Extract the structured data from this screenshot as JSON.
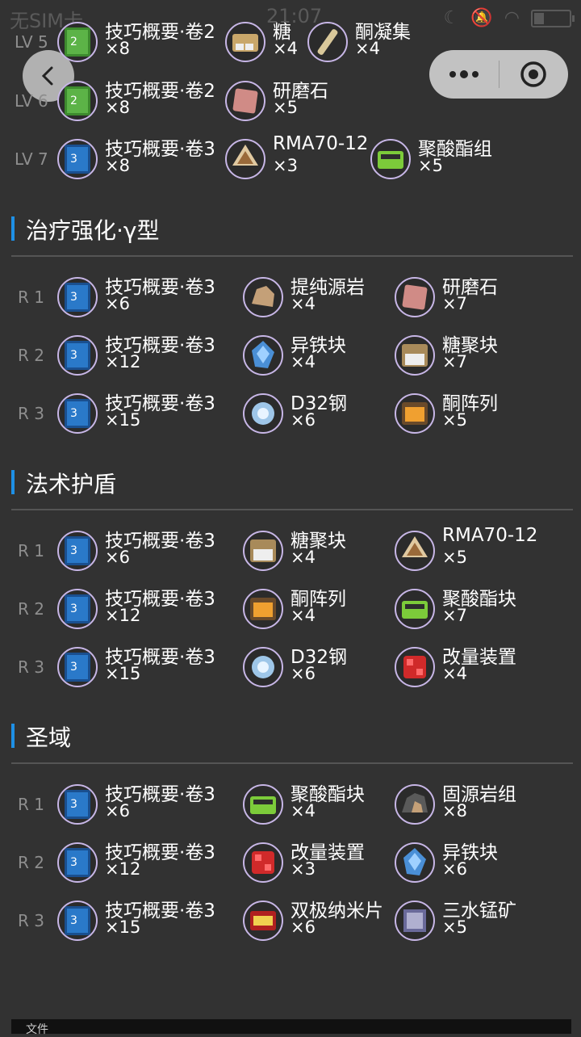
{
  "status": {
    "carrier": "无SIM卡",
    "time": "21:07",
    "battery_level": 0.3
  },
  "nav": {
    "back_icon": "chevron-left-icon",
    "more_icon": "more-dots-icon",
    "close_icon": "target-icon"
  },
  "colors": {
    "accent": "#1e90e6",
    "background": "#323232"
  },
  "upper_rows": [
    {
      "label": "LV 5",
      "items": [
        {
          "name": "技巧概要·卷2",
          "count": "×8",
          "icon": "skill-book-green"
        },
        {
          "name": "糖",
          "count": "×4",
          "icon": "sugar"
        },
        {
          "name": "酮凝集",
          "count": "×4",
          "icon": "oriron-vial"
        }
      ]
    },
    {
      "label": "LV 6",
      "items": [
        {
          "name": "技巧概要·卷2",
          "count": "×8",
          "icon": "skill-book-green"
        },
        {
          "name": "研磨石",
          "count": "×5",
          "icon": "grindstone"
        }
      ]
    },
    {
      "label": "LV 7",
      "items": [
        {
          "name": "技巧概要·卷3",
          "count": "×8",
          "icon": "skill-book-blue"
        },
        {
          "name": "RMA70-12",
          "count": "×3",
          "icon": "rma"
        },
        {
          "name": "聚酸酯组",
          "count": "×5",
          "icon": "polyester"
        }
      ]
    }
  ],
  "sections": [
    {
      "title": "治疗强化·γ型",
      "rows": [
        {
          "rank": "R 1",
          "items": [
            {
              "name": "技巧概要·卷3",
              "count": "×6",
              "icon": "skill-book-blue"
            },
            {
              "name": "提纯源岩",
              "count": "×4",
              "icon": "orirock"
            },
            {
              "name": "研磨石",
              "count": "×7",
              "icon": "grindstone"
            }
          ]
        },
        {
          "rank": "R 2",
          "items": [
            {
              "name": "技巧概要·卷3",
              "count": "×12",
              "icon": "skill-book-blue"
            },
            {
              "name": "异铁块",
              "count": "×4",
              "icon": "device-crystal"
            },
            {
              "name": "糖聚块",
              "count": "×7",
              "icon": "sugar-pack"
            }
          ]
        },
        {
          "rank": "R 3",
          "items": [
            {
              "name": "技巧概要·卷3",
              "count": "×15",
              "icon": "skill-book-blue"
            },
            {
              "name": "D32钢",
              "count": "×6",
              "icon": "d32"
            },
            {
              "name": "酮阵列",
              "count": "×5",
              "icon": "ketone-array"
            }
          ]
        }
      ]
    },
    {
      "title": "法术护盾",
      "rows": [
        {
          "rank": "R 1",
          "items": [
            {
              "name": "技巧概要·卷3",
              "count": "×6",
              "icon": "skill-book-blue"
            },
            {
              "name": "糖聚块",
              "count": "×4",
              "icon": "sugar-pack"
            },
            {
              "name": "RMA70-12",
              "count": "×5",
              "icon": "rma"
            }
          ]
        },
        {
          "rank": "R 2",
          "items": [
            {
              "name": "技巧概要·卷3",
              "count": "×12",
              "icon": "skill-book-blue"
            },
            {
              "name": "酮阵列",
              "count": "×4",
              "icon": "ketone-array"
            },
            {
              "name": "聚酸酯块",
              "count": "×7",
              "icon": "polyester"
            }
          ]
        },
        {
          "rank": "R 3",
          "items": [
            {
              "name": "技巧概要·卷3",
              "count": "×15",
              "icon": "skill-book-blue"
            },
            {
              "name": "D32钢",
              "count": "×6",
              "icon": "d32"
            },
            {
              "name": "改量装置",
              "count": "×4",
              "icon": "device-red"
            }
          ]
        }
      ]
    },
    {
      "title": "圣域",
      "rows": [
        {
          "rank": "R 1",
          "items": [
            {
              "name": "技巧概要·卷3",
              "count": "×6",
              "icon": "skill-book-blue"
            },
            {
              "name": "聚酸酯块",
              "count": "×4",
              "icon": "polyester"
            },
            {
              "name": "固源岩组",
              "count": "×8",
              "icon": "orirock-cluster"
            }
          ]
        },
        {
          "rank": "R 2",
          "items": [
            {
              "name": "技巧概要·卷3",
              "count": "×12",
              "icon": "skill-book-blue"
            },
            {
              "name": "改量装置",
              "count": "×3",
              "icon": "device-red"
            },
            {
              "name": "异铁块",
              "count": "×6",
              "icon": "device-crystal"
            }
          ]
        },
        {
          "rank": "R 3",
          "items": [
            {
              "name": "技巧概要·卷3",
              "count": "×15",
              "icon": "skill-book-blue"
            },
            {
              "name": "双极纳米片",
              "count": "×6",
              "icon": "nanoflake"
            },
            {
              "name": "三水锰矿",
              "count": "×5",
              "icon": "manganese"
            }
          ]
        }
      ]
    }
  ],
  "footer": {
    "text": "文件"
  }
}
